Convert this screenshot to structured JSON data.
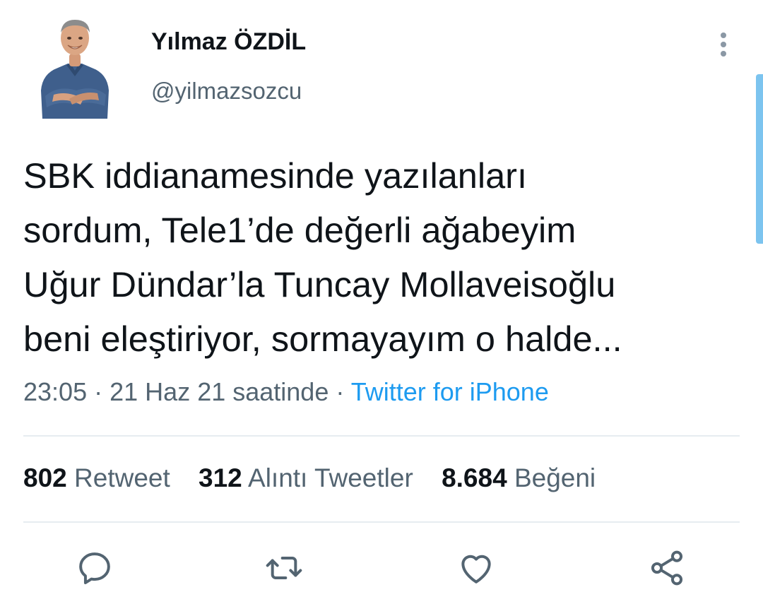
{
  "user": {
    "display_name": "Yılmaz ÖZDİL",
    "handle": "@yilmazsozcu"
  },
  "tweet": {
    "lines": [
      "SBK iddianamesinde yazılanları",
      "sordum, Tele1’de değerli ağabeyim",
      "Uğur Dündar’la Tuncay Mollaveisoğlu",
      "beni eleştiriyor, sormayayım o halde..."
    ],
    "time": "23:05",
    "date": "21 Haz 21 saatinde",
    "separator": "·",
    "source": "Twitter for iPhone"
  },
  "stats": {
    "retweets": {
      "count": "802",
      "label": "Retweet"
    },
    "quotes": {
      "count": "312",
      "label": "Alıntı Tweetler"
    },
    "likes": {
      "count": "8.684",
      "label": "Beğeni"
    }
  },
  "actions": {
    "reply": "reply-icon",
    "retweet": "retweet-icon",
    "like": "heart-icon",
    "share": "share-icon"
  },
  "colors": {
    "accent": "#1d9bf0",
    "text_primary": "#0f1419",
    "text_secondary": "#536471",
    "divider": "#e6ecf0"
  }
}
